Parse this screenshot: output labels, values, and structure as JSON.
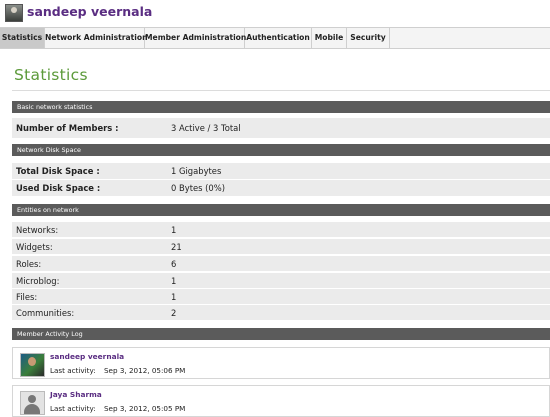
{
  "header": {
    "user_name": "sandeep veernala",
    "avatar_icon": "user-avatar"
  },
  "tabs": [
    {
      "label": "Statistics",
      "active": true
    },
    {
      "label": "Network Administration",
      "active": false
    },
    {
      "label": "Member Administration",
      "active": false
    },
    {
      "label": "Authentication",
      "active": false
    },
    {
      "label": "Mobile",
      "active": false
    },
    {
      "label": "Security",
      "active": false
    }
  ],
  "page_title": "Statistics",
  "sections": {
    "basic": {
      "header": "Basic network statistics",
      "rows": [
        {
          "key": "Number of Members :",
          "value": "3 Active / 3 Total"
        }
      ]
    },
    "disk": {
      "header": "Network Disk Space",
      "rows": [
        {
          "key": "Total Disk Space :",
          "value": "1 Gigabytes"
        },
        {
          "key": "Used Disk Space :",
          "value": "0 Bytes (0%)"
        }
      ]
    },
    "entities": {
      "header": "Entities on network",
      "rows": [
        {
          "key": "Networks:",
          "value": "1"
        },
        {
          "key": "Widgets:",
          "value": "21"
        },
        {
          "key": "Roles:",
          "value": "6"
        },
        {
          "key": "Microblog:",
          "value": "1"
        },
        {
          "key": "Files:",
          "value": "1"
        },
        {
          "key": "Communities:",
          "value": "2"
        }
      ]
    },
    "activity": {
      "header": "Member Activity Log",
      "items": [
        {
          "name": "sandeep veernala",
          "label": "Last activity:",
          "time": "Sep 3, 2012,  05:06 PM",
          "avatar": "user-photo"
        },
        {
          "name": "Jaya Sharma",
          "label": "Last activity:",
          "time": "Sep 3, 2012,  05:05 PM",
          "avatar": "default-avatar"
        }
      ]
    }
  },
  "colors": {
    "title": "#5c9a3a",
    "user_name": "#5a2d82",
    "section_bar": "#5b5b5b",
    "row_bg": "#ebebeb",
    "active_tab": "#c9c9c9"
  }
}
